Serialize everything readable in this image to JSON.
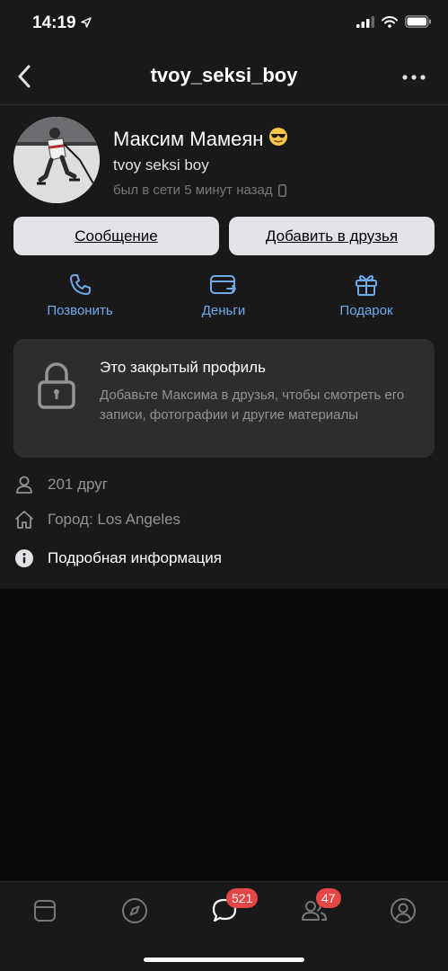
{
  "status_bar": {
    "time": "14:19"
  },
  "nav": {
    "title": "tvoy_seksi_boy"
  },
  "profile": {
    "name": "Максим Мамеян",
    "emoji": "😎",
    "subtitle": "tvoy seksi boy",
    "online_status": "был в сети 5 минут назад"
  },
  "buttons": {
    "message": "Сообщение",
    "add_friend": "Добавить в друзья"
  },
  "quick_actions": [
    {
      "label": "Позвонить",
      "icon": "phone-icon"
    },
    {
      "label": "Деньги",
      "icon": "money-transfer-icon"
    },
    {
      "label": "Подарок",
      "icon": "gift-icon"
    }
  ],
  "private_profile": {
    "title": "Это закрытый профиль",
    "text": "Добавьте Максима в друзья, чтобы смотреть его записи, фотографии и другие материалы"
  },
  "info": {
    "friends": "201 друг",
    "city": "Город: Los Angeles",
    "details": "Подробная информация"
  },
  "tab_bar": {
    "messages_badge": "521",
    "friends_badge": "47"
  },
  "colors": {
    "background": "#191919",
    "accent": "#71aaeb",
    "badge": "#e64646",
    "card": "#2c2d2e"
  }
}
